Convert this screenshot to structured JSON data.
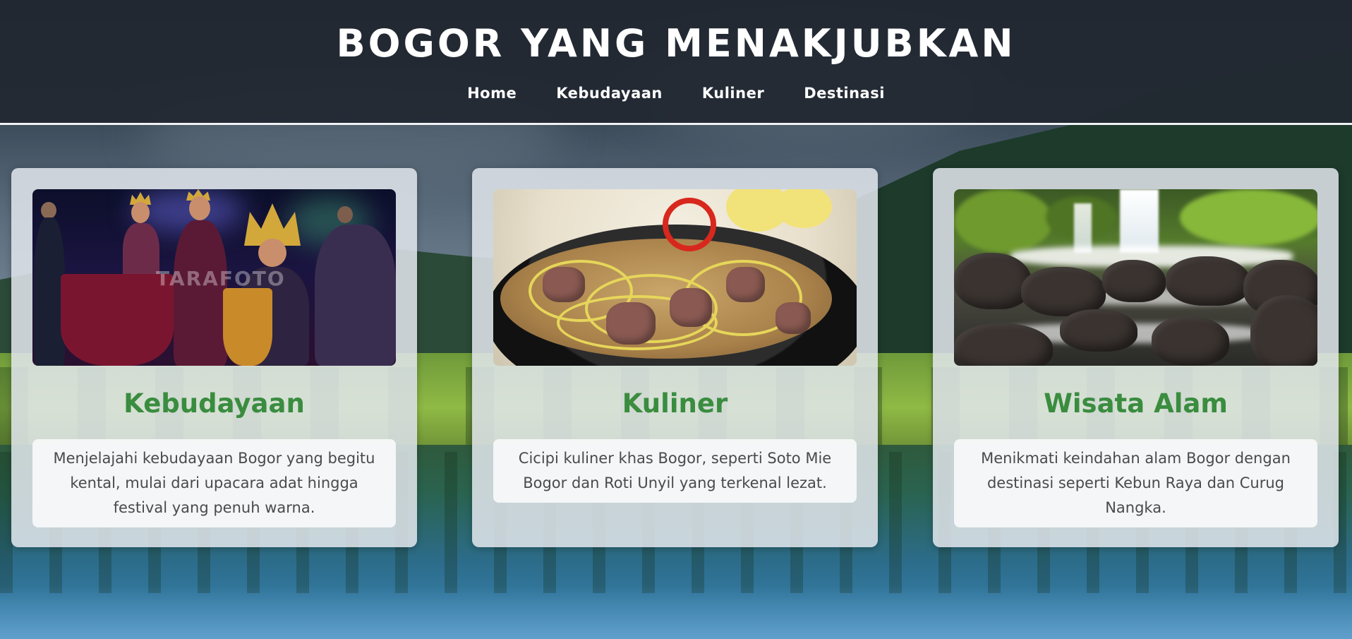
{
  "header": {
    "title": "BOGOR YANG MENAKJUBKAN",
    "nav": [
      {
        "label": "Home"
      },
      {
        "label": "Kebudayaan"
      },
      {
        "label": "Kuliner"
      },
      {
        "label": "Destinasi"
      }
    ]
  },
  "cards": [
    {
      "title": "Kebudayaan",
      "text": "Menjelajahi kebudayaan Bogor yang begitu kental, mulai dari upacara adat hingga festival yang penuh warna.",
      "image_watermark": "TARAFOTO"
    },
    {
      "title": "Kuliner",
      "text": "Cicipi kuliner khas Bogor, seperti Soto Mie Bogor dan Roti Unyil yang terkenal lezat."
    },
    {
      "title": "Wisata Alam",
      "text": "Menikmati keindahan alam Bogor dengan destinasi seperti Kebun Raya dan Curug Nangka."
    }
  ],
  "colors": {
    "header_bg": "#212831",
    "card_title": "#3a8c3f",
    "card_bg": "#e2e7ec",
    "text": "#4a4a4a"
  }
}
